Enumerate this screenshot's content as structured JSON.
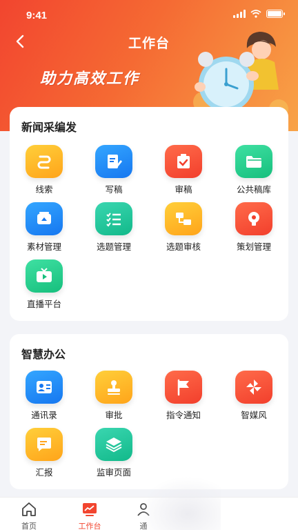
{
  "status": {
    "time": "9:41"
  },
  "nav": {
    "title": "工作台"
  },
  "banner": {
    "slogan": "助力高效工作"
  },
  "section1": {
    "title": "新闻采编发",
    "items": [
      {
        "label": "线索",
        "icon": "clue-icon",
        "color": "yellow"
      },
      {
        "label": "写稿",
        "icon": "write-icon",
        "color": "blue"
      },
      {
        "label": "审稿",
        "icon": "review-icon",
        "color": "red"
      },
      {
        "label": "公共稿库",
        "icon": "folder-icon",
        "color": "green"
      },
      {
        "label": "素材管理",
        "icon": "media-icon",
        "color": "blue"
      },
      {
        "label": "选题管理",
        "icon": "list-icon",
        "color": "teal"
      },
      {
        "label": "选题审核",
        "icon": "flow-icon",
        "color": "yellow"
      },
      {
        "label": "策划管理",
        "icon": "bulb-icon",
        "color": "red"
      },
      {
        "label": "直播平台",
        "icon": "tv-icon",
        "color": "green"
      }
    ]
  },
  "section2": {
    "title": "智慧办公",
    "items": [
      {
        "label": "通讯录",
        "icon": "contacts-icon",
        "color": "blue"
      },
      {
        "label": "审批",
        "icon": "stamp-icon",
        "color": "yellow"
      },
      {
        "label": "指令通知",
        "icon": "flag-icon",
        "color": "red"
      },
      {
        "label": "智媒风",
        "icon": "pinwheel-icon",
        "color": "red"
      },
      {
        "label": "汇报",
        "icon": "report-icon",
        "color": "yellow"
      },
      {
        "label": "监审页面",
        "icon": "layers-icon",
        "color": "teal"
      }
    ]
  },
  "tabbar": {
    "items": [
      {
        "label": "首页",
        "icon": "home-icon"
      },
      {
        "label": "工作台",
        "icon": "workbench-icon",
        "active": true
      },
      {
        "label": "通",
        "icon": "contacts-tab-icon"
      }
    ]
  }
}
